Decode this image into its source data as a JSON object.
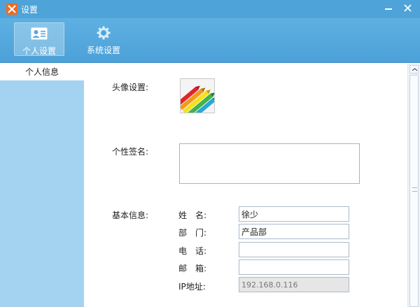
{
  "window": {
    "title": "设置"
  },
  "toolbar": {
    "personal_label": "个人设置",
    "system_label": "系统设置"
  },
  "sidebar": {
    "items": [
      {
        "label": "个人信息"
      }
    ]
  },
  "form": {
    "avatar_label": "头像设置:",
    "signature_label": "个性签名:",
    "signature_value": "",
    "basic_label": "基本信息:",
    "fields": [
      {
        "label": "姓　名:",
        "value": "徐少",
        "disabled": false
      },
      {
        "label": "部　门:",
        "value": "产品部",
        "disabled": false
      },
      {
        "label": "电　话:",
        "value": "",
        "disabled": false
      },
      {
        "label": "邮　箱:",
        "value": "",
        "disabled": false
      },
      {
        "label": "IP地址:",
        "value": "192.168.0.116",
        "disabled": true
      }
    ]
  },
  "colors": {
    "titlebar": "#4ea3d9",
    "sidebar": "#a4d3f2",
    "app_icon": "#f06a1e"
  }
}
